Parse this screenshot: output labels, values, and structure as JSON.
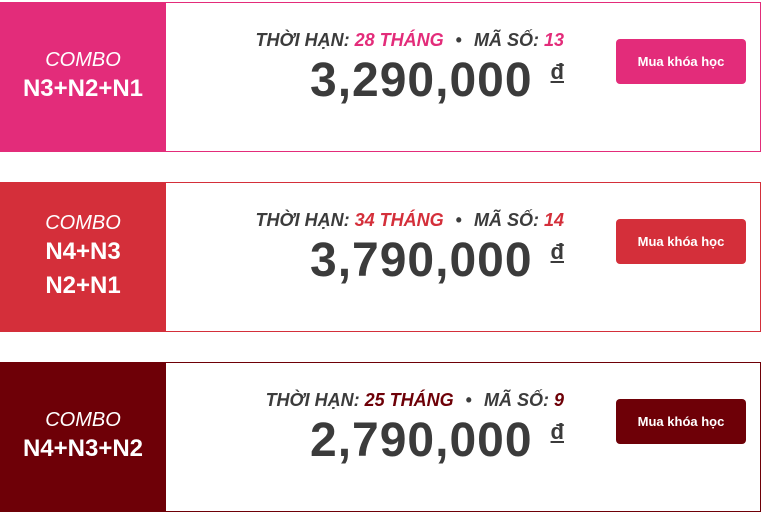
{
  "labels": {
    "duration": "THỜI HẠN:",
    "code": "MÃ SỐ:",
    "separator": "•",
    "currency": "đ",
    "buy_button": "Mua khóa học",
    "combo": "COMBO"
  },
  "combos": [
    {
      "lines": [
        "N3+N2+N1"
      ],
      "duration": "28 THÁNG",
      "code": "13",
      "price": "3,290,000",
      "color": "#e32c7a"
    },
    {
      "lines": [
        "N4+N3",
        "N2+N1"
      ],
      "duration": "34 THÁNG",
      "code": "14",
      "price": "3,790,000",
      "color": "#d42f3a"
    },
    {
      "lines": [
        "N4+N3+N2"
      ],
      "duration": "25 THÁNG",
      "code": "9",
      "price": "2,790,000",
      "color": "#6e0007"
    }
  ]
}
